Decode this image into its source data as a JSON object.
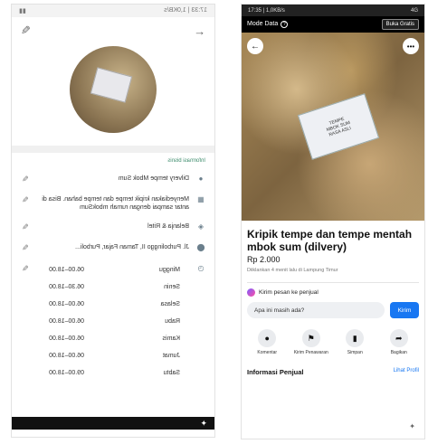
{
  "left": {
    "status_text": "17:33 | 1,0KB/s",
    "section_label": "Informasi bisnis",
    "rows": [
      {
        "icon": "person-icon",
        "text": "Dilvery tempe Mbok Sum"
      },
      {
        "icon": "store-icon",
        "text": "Menyediakan kripik tempe dan tempe bahan. Bisa di antar sampai dengan rumah mbokSum"
      },
      {
        "icon": "category-icon",
        "text": "Belanja & Ritel"
      },
      {
        "icon": "location-icon",
        "text": "Jl. Purbolinggo II, Taman Fajar, Purboli..."
      }
    ],
    "hours": [
      {
        "day": "Minggu",
        "time": "06.00–18.00"
      },
      {
        "day": "Senin",
        "time": "06.30–18.00"
      },
      {
        "day": "Selasa",
        "time": "06.00–18.00"
      },
      {
        "day": "Rabu",
        "time": "06.00–18.00"
      },
      {
        "day": "Kamis",
        "time": "06.00–18.00"
      },
      {
        "day": "Jumat",
        "time": "06.00–18.00"
      },
      {
        "day": "Sabtu",
        "time": "09.00–18.00"
      }
    ]
  },
  "right": {
    "status_left": "17:35 | 1,0KB/s",
    "status_right": "4G ",
    "data_mode_label": "Mode Data",
    "free_button": "Buka Gratis",
    "photo_label_lines": [
      "TEMPE",
      "MBOK SUM",
      "RASA ASLI"
    ],
    "title": "Kripik tempe dan tempe mentah mbok sum (dilvery)",
    "price": "Rp 2.000",
    "meta": "Diiklankan 4 menit lalu di Lampung Timur",
    "message_header": "Kirim pesan ke penjual",
    "message_input": "Apa ini masih ada?",
    "send_button": "Kirim",
    "actions": [
      {
        "icon": "comment-icon",
        "label": "Komentar"
      },
      {
        "icon": "offer-icon",
        "label": "Kirim Penawaran"
      },
      {
        "icon": "bookmark-icon",
        "label": "Simpan"
      },
      {
        "icon": "share-icon",
        "label": "Bagikan"
      }
    ],
    "info_title": "Informasi Penjual",
    "info_link": "Lihat Profil"
  }
}
